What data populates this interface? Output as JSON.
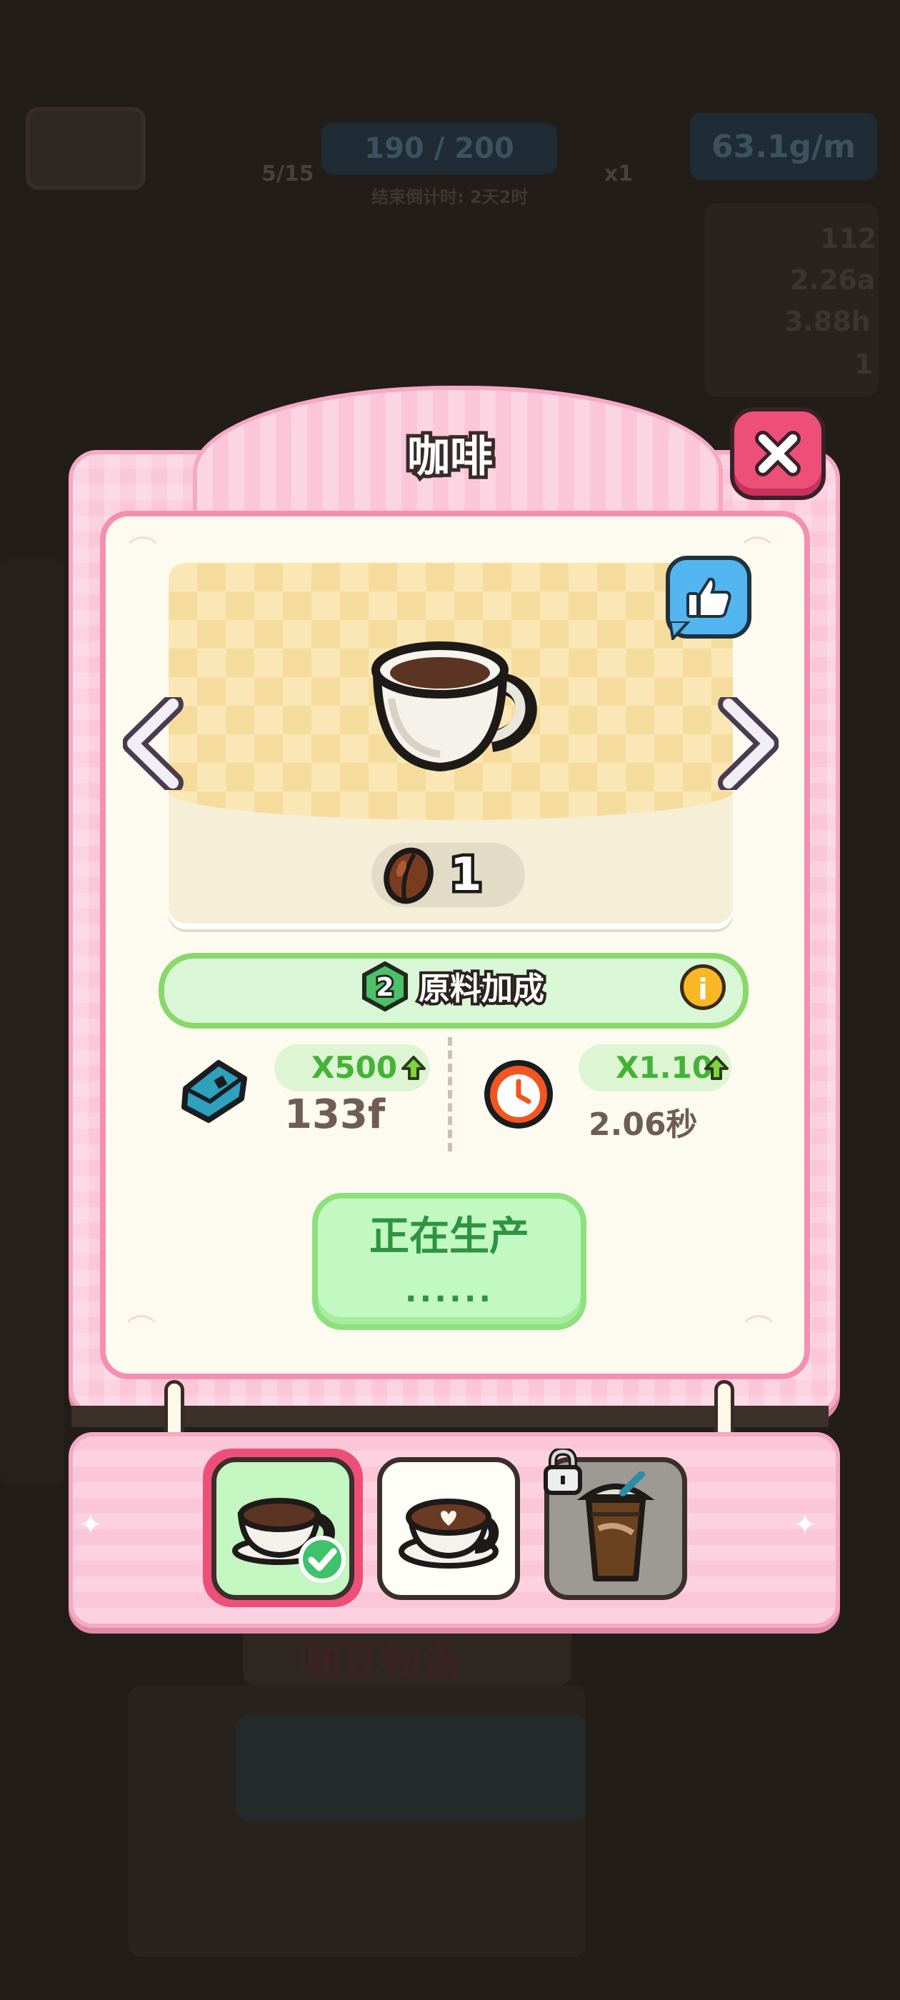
{
  "background": {
    "hud_progress_text": "190 / 200",
    "hud_level_text": "5/15",
    "hud_countdown_text": "结束倒计时: 2天2时",
    "hud_multiplier_text": "x1",
    "hud_rate_text": "63.1g/m",
    "side_stats": [
      "112",
      "2.26a",
      "3.88h",
      "1"
    ],
    "shop_sign": "咖豆物语"
  },
  "dialog": {
    "title": "咖啡",
    "close_icon": "close-x-icon",
    "showcase": {
      "item_icon": "coffee-cup-icon",
      "cost_icon": "coffee-bean-icon",
      "cost_value": "1",
      "like_icon": "thumbs-up-icon",
      "prev_icon": "chevron-left-icon",
      "next_icon": "chevron-right-icon"
    },
    "bonus": {
      "level": "2",
      "label": "原料加成",
      "info_icon": "info-icon",
      "info_text": "i"
    },
    "stats": {
      "value": {
        "icon": "blue-gem-block-icon",
        "multiplier": "X500",
        "amount": "133f",
        "arrow_icon": "green-up-arrow-icon"
      },
      "speed": {
        "icon": "clock-icon",
        "multiplier": "X1.10",
        "amount": "2.06秒",
        "arrow_icon": "green-up-arrow-icon"
      }
    },
    "produce_button": {
      "label": "正在生产",
      "sub": "......"
    }
  },
  "selector": {
    "slots": [
      {
        "name": "espresso-cup",
        "icon": "coffee-cup-icon",
        "state": "selected",
        "badge_icon": "checkmark-icon"
      },
      {
        "name": "latte-art-cup",
        "icon": "latte-cup-icon",
        "state": "available"
      },
      {
        "name": "iced-coffee",
        "icon": "iced-coffee-icon",
        "state": "locked",
        "badge_icon": "padlock-icon"
      }
    ]
  },
  "colors": {
    "panel_pink": "#fbc7d8",
    "panel_border_pink": "#f58fb0",
    "cream": "#fdfbef",
    "green_text": "#2f9441",
    "green_light": "#c2f8c2",
    "close_red": "#ee4f78",
    "like_blue": "#53b5ef"
  }
}
